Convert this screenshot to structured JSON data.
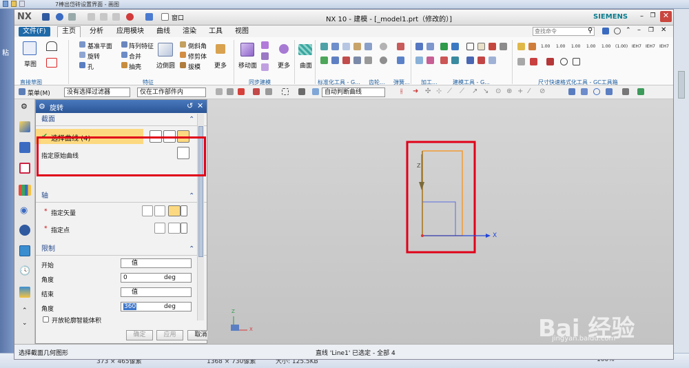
{
  "outer": {
    "title": "7棒出岱砖设置界面 - 画图",
    "status_items": [
      "373 × 465像素",
      "1368 × 730像素",
      "大小: 125.5KB",
      "100%"
    ],
    "left_text": "粘"
  },
  "window": {
    "logo": "NX",
    "title": "NX 10 - 建模 - [_model1.prt（修改的）]",
    "brand": "SIEMENS",
    "quick_access_label": "窗口"
  },
  "menu": {
    "tabs": [
      "文件(F)",
      "主页",
      "分析",
      "应用模块",
      "曲线",
      "渲染",
      "工具",
      "视图"
    ],
    "search_placeholder": "查找命令"
  },
  "ribbon": {
    "sketch": "草图",
    "feature_items": [
      "基准平面",
      "阵列特征",
      "旋转",
      "合并",
      "孔",
      "抽壳"
    ],
    "edge_blend": "边倒圆",
    "chamfer_items": [
      "倒斜角",
      "修剪体",
      "拔模"
    ],
    "more": "更多",
    "move_face": "移动面",
    "surface": "曲面",
    "groups": [
      "直接草图",
      "特征",
      "同步建模",
      "标准化工具 - G...",
      "齿轮...",
      "弹簧...",
      "加工...",
      "建模工具 - G...",
      "尺寸快速格式化工具 - GC工具箱"
    ],
    "dim_labels": [
      "1.00",
      "1.00",
      "1.00",
      "1.00",
      "1.00",
      "(1.00)",
      "IEH7",
      "IEH7",
      "IEH7"
    ]
  },
  "toolbar2": {
    "menu": "菜单(M)",
    "filter": "没有选择过滤器",
    "scope": "仅在工作部件内",
    "curve_rule": "自动判断曲线"
  },
  "dialog": {
    "title": "旋转",
    "section": "截面",
    "select_curve": "选择曲线 (4)",
    "specify_original": "指定原始曲线",
    "axis": "轴",
    "specify_vector": "指定矢量",
    "specify_point": "指定点",
    "limits": "限制",
    "start": "开始",
    "start_type": "值",
    "angle_label": "角度",
    "start_angle": "0",
    "unit": "deg",
    "end": "结束",
    "end_type": "值",
    "end_angle": "360",
    "open_profile": "开放轮廓智能体积",
    "ok": "确定",
    "apply": "应用",
    "cancel": "取消"
  },
  "viewport": {
    "axis_x": "X",
    "axis_z": "Z",
    "triad_x": "X",
    "triad_z": "Z"
  },
  "status": {
    "left": "选择截面几何图形",
    "center": "直线 'Line1' 已选定 - 全部 4"
  },
  "watermark": {
    "brand": "Bai  经验",
    "url": "jingyan.baidu.com"
  },
  "colors": {
    "highlight": "#e00018",
    "selection_fill": "#fcd980",
    "curve_orange": "#f29a33",
    "axis_blue": "#2447d9",
    "file_tab": "#1f6aa8"
  }
}
